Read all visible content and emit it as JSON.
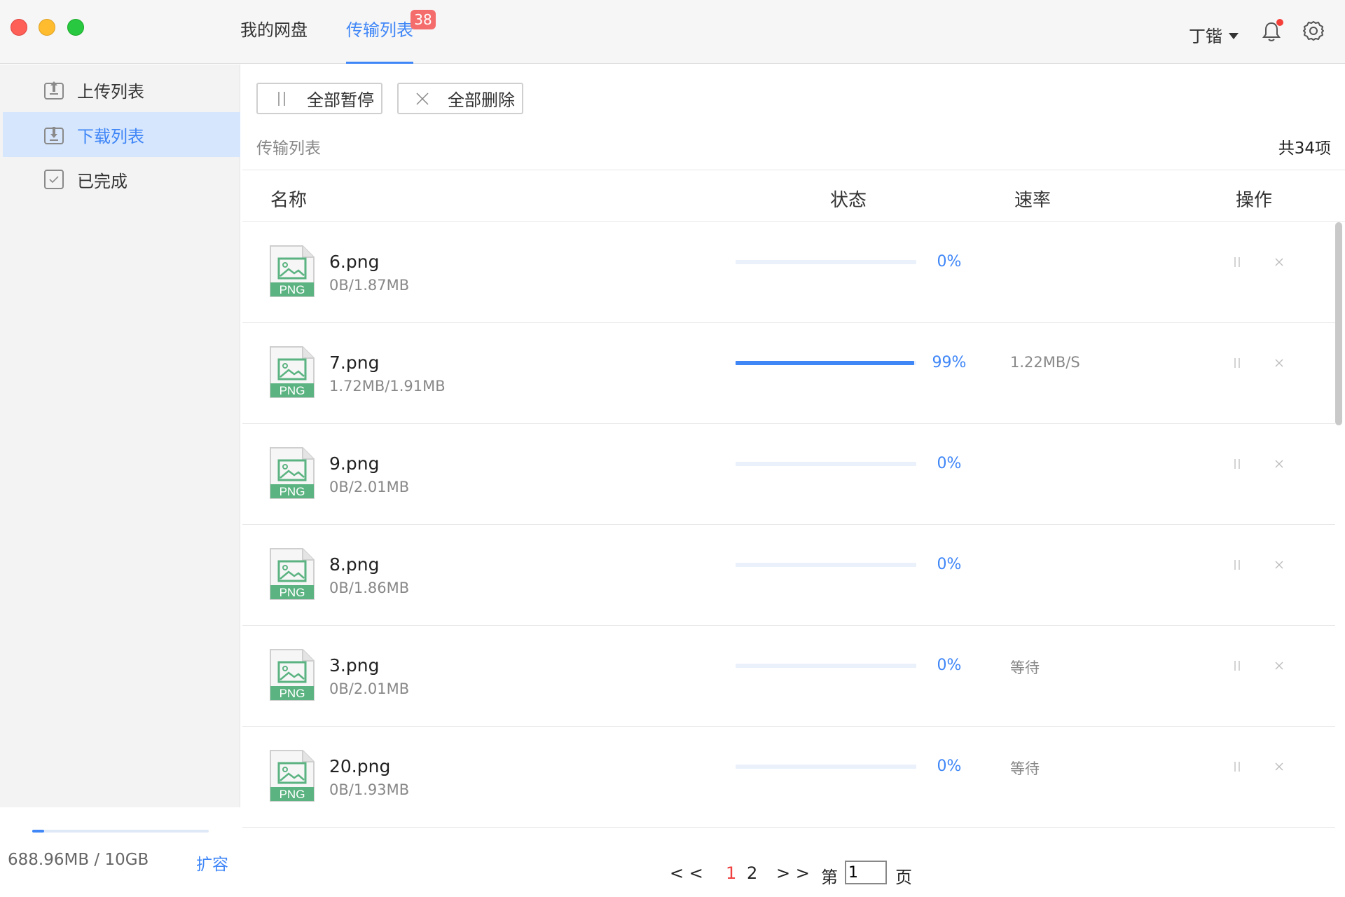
{
  "window": {
    "nav_tabs": [
      {
        "label": "我的网盘"
      },
      {
        "label": "传输列表",
        "badge": "38"
      }
    ],
    "user_name": "丁锴"
  },
  "sidebar": {
    "items": [
      {
        "label": "上传列表",
        "icon": "upload-icon"
      },
      {
        "label": "下载列表",
        "icon": "download-icon"
      },
      {
        "label": "已完成",
        "icon": "check-icon"
      }
    ],
    "storage": {
      "used_text": "688.96MB / 10GB",
      "used_fraction": 0.067,
      "expand_label": "扩容"
    }
  },
  "toolbar": {
    "pause_all": "全部暂停",
    "delete_all": "全部删除"
  },
  "list": {
    "title": "传输列表",
    "count": "共34项",
    "columns": {
      "name": "名称",
      "status": "状态",
      "rate": "速率",
      "action": "操作"
    },
    "file_type_label": "PNG",
    "rows": [
      {
        "name": "6.png",
        "size": "0B/1.87MB",
        "progress": 0,
        "percent": "0%",
        "rate": ""
      },
      {
        "name": "7.png",
        "size": "1.72MB/1.91MB",
        "progress": 99,
        "percent": "99%",
        "rate": "1.22MB/S"
      },
      {
        "name": "9.png",
        "size": "0B/2.01MB",
        "progress": 0,
        "percent": "0%",
        "rate": ""
      },
      {
        "name": "8.png",
        "size": "0B/1.86MB",
        "progress": 0,
        "percent": "0%",
        "rate": ""
      },
      {
        "name": "3.png",
        "size": "0B/2.01MB",
        "progress": 0,
        "percent": "0%",
        "rate": "等待"
      },
      {
        "name": "20.png",
        "size": "0B/1.93MB",
        "progress": 0,
        "percent": "0%",
        "rate": "等待"
      },
      {
        "name": "",
        "size": "",
        "progress": 0,
        "percent": "",
        "rate": ""
      }
    ]
  },
  "pager": {
    "prev": "< <",
    "pages": [
      "1",
      "2"
    ],
    "current": "1",
    "next": "> >",
    "prefix": "第",
    "input_value": "1",
    "suffix": "页"
  },
  "colors": {
    "accent": "#3f86f7",
    "badge": "#f56c6c",
    "file_icon": "#5bb381",
    "current_page": "#f04040"
  }
}
